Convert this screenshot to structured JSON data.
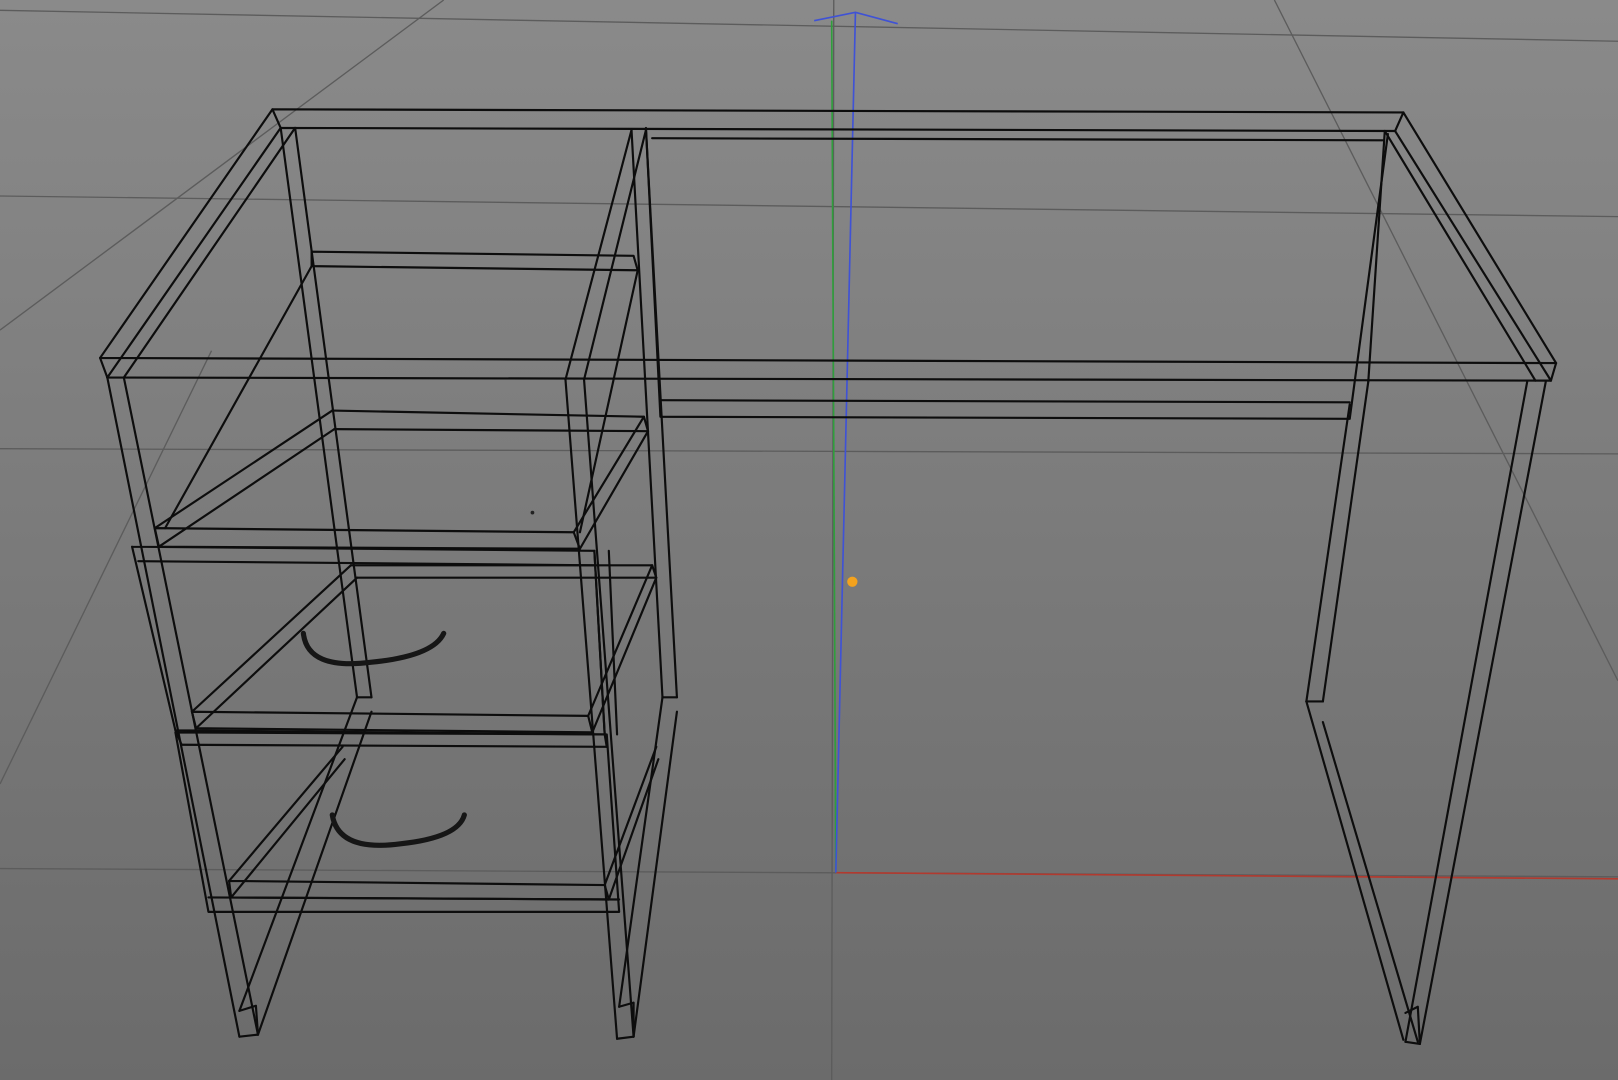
{
  "app": {
    "view": "perspective-viewport",
    "mode": "wireframe"
  },
  "colors": {
    "background_top": "#8a8a8a",
    "background_bottom": "#6b6b6b",
    "grid": "#5c5c5c",
    "wire": "#0d0d0d",
    "axis_x": "#b23a2f",
    "axis_y": "#2f9e3c",
    "axis_z": "#3f52d6",
    "pivot": "#f3a21d"
  },
  "scene": {
    "object": "desk",
    "components": [
      "tabletop",
      "drawer-cabinet",
      "top-drawer",
      "bottom-drawer",
      "drawer-handle-top",
      "drawer-handle-bottom",
      "right-leg-frame",
      "modesty-panel"
    ],
    "icons": [
      "axis-gizmo-icon",
      "pivot-point-icon"
    ]
  }
}
